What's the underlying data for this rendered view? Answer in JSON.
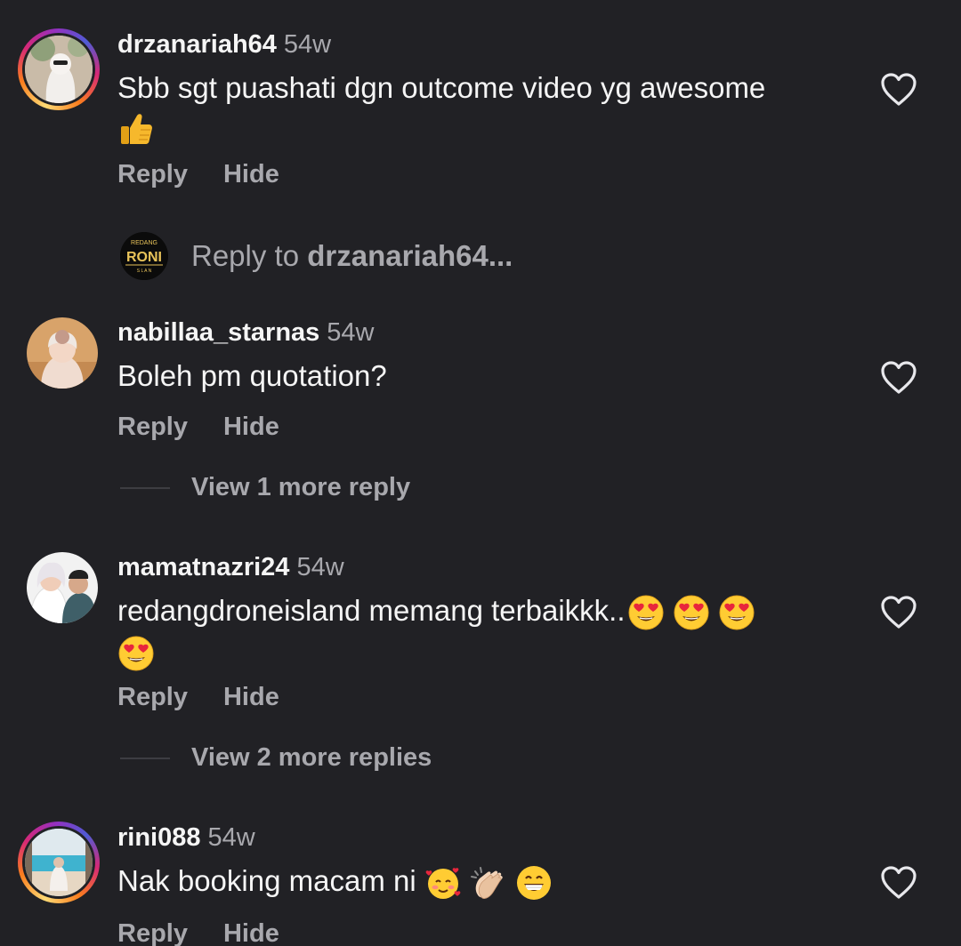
{
  "reply_compose": {
    "logo_text": "REDANG",
    "logo_word": "RONI",
    "prefix": "Reply to ",
    "target": "drzanariah64..."
  },
  "comments": [
    {
      "username": "drzanariah64",
      "time": "54w",
      "text": "Sbb sgt puashati dgn outcome video yg awesome",
      "emojis": [
        "thumbs-up"
      ],
      "reply_label": "Reply",
      "hide_label": "Hide"
    },
    {
      "username": "nabillaa_starnas",
      "time": "54w",
      "text": "Boleh pm quotation?",
      "reply_label": "Reply",
      "hide_label": "Hide",
      "view_more": "View 1 more reply"
    },
    {
      "username": "mamatnazri24",
      "time": "54w",
      "text": "redangdroneisland memang terbaikkk..",
      "emojis": [
        "heart-eyes",
        "heart-eyes",
        "heart-eyes",
        "heart-eyes"
      ],
      "reply_label": "Reply",
      "hide_label": "Hide",
      "view_more": "View 2 more replies"
    },
    {
      "username": "rini088",
      "time": "54w",
      "text": "Nak booking macam ni",
      "emojis": [
        "smiling-face-with-hearts",
        "clapping-hands",
        "grinning-face"
      ],
      "reply_label": "Reply",
      "hide_label": "Hide"
    }
  ],
  "colors": {
    "background": "#212125",
    "text": "#f5f5f5",
    "secondary": "#a8a8ad"
  }
}
